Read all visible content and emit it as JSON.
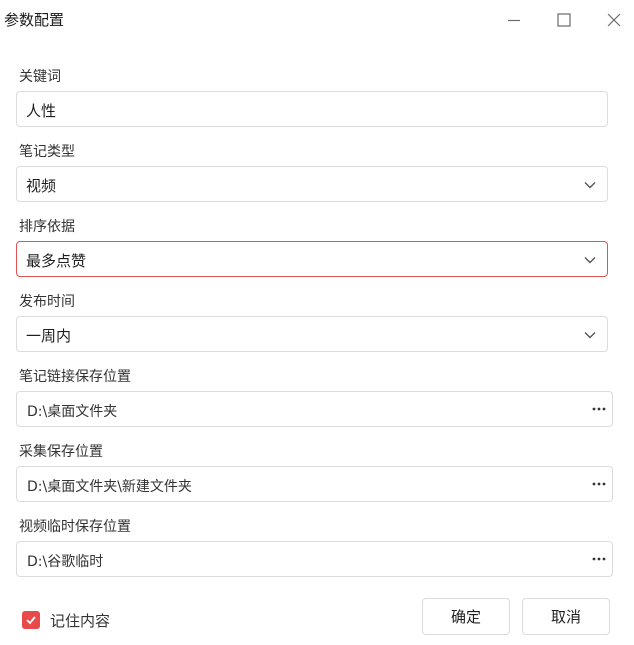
{
  "window": {
    "title": "参数配置",
    "controls": [
      "minimize-icon",
      "maximize-icon",
      "close-icon"
    ]
  },
  "fields": {
    "keyword": {
      "label": "关键词",
      "value": "人性"
    },
    "note_type": {
      "label": "笔记类型",
      "value": "视频"
    },
    "sort_by": {
      "label": "排序依据",
      "value": "最多点赞"
    },
    "publish_time": {
      "label": "发布时间",
      "value": "一周内"
    },
    "link_save_path": {
      "label": "笔记链接保存位置",
      "value": "D:\\桌面文件夹"
    },
    "collect_save_path": {
      "label": "采集保存位置",
      "value": "D:\\桌面文件夹\\新建文件夹"
    },
    "video_temp_path": {
      "label": "视频临时保存位置",
      "value": "D:\\谷歌临时"
    }
  },
  "remember": {
    "label": "记住内容",
    "checked": true
  },
  "buttons": {
    "ok": "确定",
    "cancel": "取消"
  },
  "colors": {
    "accent": "#e84a4a",
    "error_border": "#e05454",
    "border": "#dcdcdc"
  }
}
